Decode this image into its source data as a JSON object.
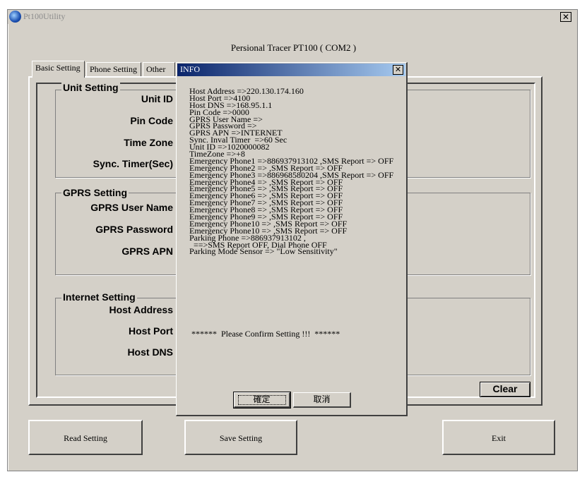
{
  "window": {
    "title": "Pt100Utility",
    "close_glyph": "✕"
  },
  "app_heading": "Persional Tracer PT100 ( COM2 )",
  "tabs": [
    {
      "label": "Basic Setting"
    },
    {
      "label": "Phone Setting"
    },
    {
      "label": "Other"
    }
  ],
  "groups": {
    "unit": {
      "title": "Unit Setting",
      "fields": [
        "Unit ID",
        "Pin Code",
        "Time Zone",
        "Sync. Timer(Sec)"
      ]
    },
    "gprs": {
      "title": "GPRS Setting",
      "fields": [
        "GPRS User Name",
        "GPRS Password",
        "GPRS APN"
      ]
    },
    "internet": {
      "title": "Internet Setting",
      "fields": [
        "Host Address",
        "Host Port",
        "Host DNS"
      ]
    }
  },
  "buttons": {
    "clear": "Clear",
    "read": "Read Setting",
    "save": "Save Setting",
    "exit": "Exit"
  },
  "dialog": {
    "title": "INFO",
    "close_glyph": "✕",
    "lines": [
      "Host Address =>220.130.174.160",
      "Host Port =>4100",
      "Host DNS =>168.95.1.1",
      "Pin Code =>0000",
      "GPRS User Name =>",
      "GPRS Password =>",
      "GPRS APN =>INTERNET",
      "Sync. Inval Timer  =>60 Sec",
      "Unit ID =>1020000082",
      "TimeZone =>+8",
      "Emergency Phone1 =>886937913102 ,SMS Report => OFF",
      "Emergency Phone2 => ,SMS Report => OFF",
      "Emergency Phone3 =>886968580204 ,SMS Report => OFF",
      "Emergency Phone4 => ,SMS Report => OFF",
      "Emergency Phone5 => ,SMS Report => OFF",
      "Emergency Phone6 => ,SMS Report => OFF",
      "Emergency Phone7 => ,SMS Report => OFF",
      "Emergency Phone8 => ,SMS Report => OFF",
      "Emergency Phone9 => ,SMS Report => OFF",
      "Emergency Phone10 => ,SMS Report => OFF",
      "Emergency Phone10 => ,SMS Report => OFF",
      "Parking Phone =>886937913102 ,",
      "  ==>SMS Report OFF, Dial Phone OFF",
      "Parking Mode Sensor => \"Low Sensitivity\""
    ],
    "confirm": "******  Please Confirm Setting !!!  ******",
    "ok_label": "確定",
    "cancel_label": "取消"
  },
  "colors": {
    "face": "#d4d0c8",
    "dialog_title_start": "#0a246a",
    "dialog_title_end": "#a6caf0"
  },
  "icons": [
    "app-globe-icon",
    "close-icon"
  ]
}
